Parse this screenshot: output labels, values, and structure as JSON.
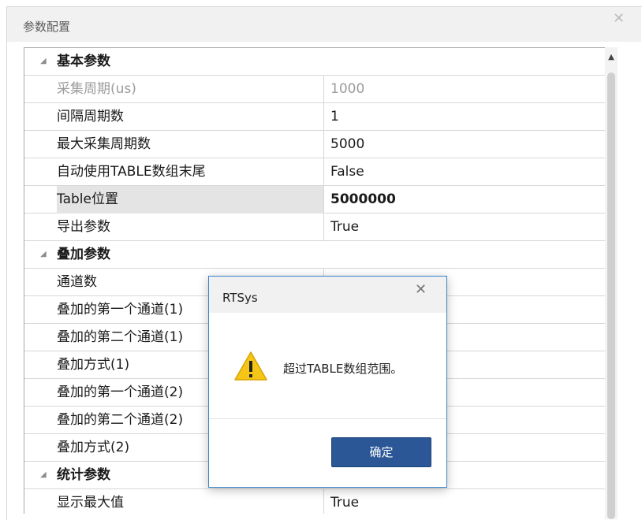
{
  "window": {
    "title": "参数配置",
    "close_glyph": "✕"
  },
  "grid": {
    "rows": [
      {
        "type": "category",
        "name": "基本参数",
        "expanded": true
      },
      {
        "type": "item",
        "name": "采集周期(us)",
        "value": "1000",
        "disabled": true
      },
      {
        "type": "item",
        "name": "间隔周期数",
        "value": "1"
      },
      {
        "type": "item",
        "name": "最大采集周期数",
        "value": "5000"
      },
      {
        "type": "item",
        "name": "自动使用TABLE数组末尾",
        "value": "False"
      },
      {
        "type": "item",
        "name": "Table位置",
        "value": "5000000",
        "selected": true
      },
      {
        "type": "item",
        "name": "导出参数",
        "value": "True"
      },
      {
        "type": "category",
        "name": "叠加参数",
        "expanded": true
      },
      {
        "type": "item",
        "name": "通道数",
        "value": ""
      },
      {
        "type": "item",
        "name": "叠加的第一个通道(1)",
        "value": ""
      },
      {
        "type": "item",
        "name": "叠加的第二个通道(1)",
        "value": ""
      },
      {
        "type": "item",
        "name": "叠加方式(1)",
        "value": ""
      },
      {
        "type": "item",
        "name": "叠加的第一个通道(2)",
        "value": ""
      },
      {
        "type": "item",
        "name": "叠加的第二个通道(2)",
        "value": ""
      },
      {
        "type": "item",
        "name": "叠加方式(2)",
        "value": ""
      },
      {
        "type": "category",
        "name": "统计参数",
        "expanded": true
      },
      {
        "type": "item",
        "name": "显示最大值",
        "value": "True"
      }
    ]
  },
  "dialog": {
    "title": "RTSys",
    "close_glyph": "✕",
    "icon": "warning-icon",
    "message": "超过TABLE数组范围。",
    "ok_label": "确定",
    "accent": "#2b5797",
    "warning_color": "#f5c518"
  },
  "scrollbar": {
    "up_glyph": "▲"
  }
}
